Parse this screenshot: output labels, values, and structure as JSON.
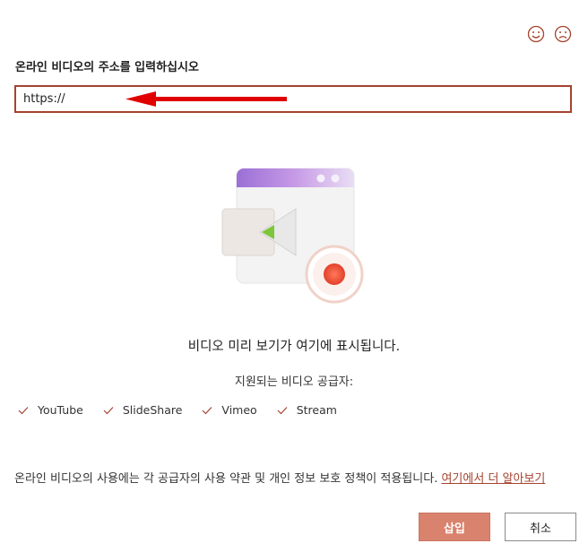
{
  "dialog": {
    "prompt_label": "온라인 비디오의 주소를 입력하십시오",
    "url_value": "https://",
    "preview_text": "비디오 미리 보기가 여기에 표시됩니다.",
    "providers_label": "지원되는 비디오 공급자:",
    "providers": [
      "YouTube",
      "SlideShare",
      "Vimeo",
      "Stream"
    ],
    "terms_text": "온라인 비디오의 사용에는 각 공급자의 사용 약관 및 개인 정보 보호 정책이 적용됩니다.",
    "learn_more_link": "여기에서 더 알아보기",
    "insert_button": "삽입",
    "cancel_button": "취소"
  },
  "colors": {
    "accent": "#a4432f",
    "insert_button_bg": "#d9826d",
    "annotation_arrow": "#e00000"
  },
  "icons": {
    "feedback_happy": "smiley-face-icon",
    "feedback_sad": "sad-face-icon",
    "check": "checkmark-icon"
  }
}
